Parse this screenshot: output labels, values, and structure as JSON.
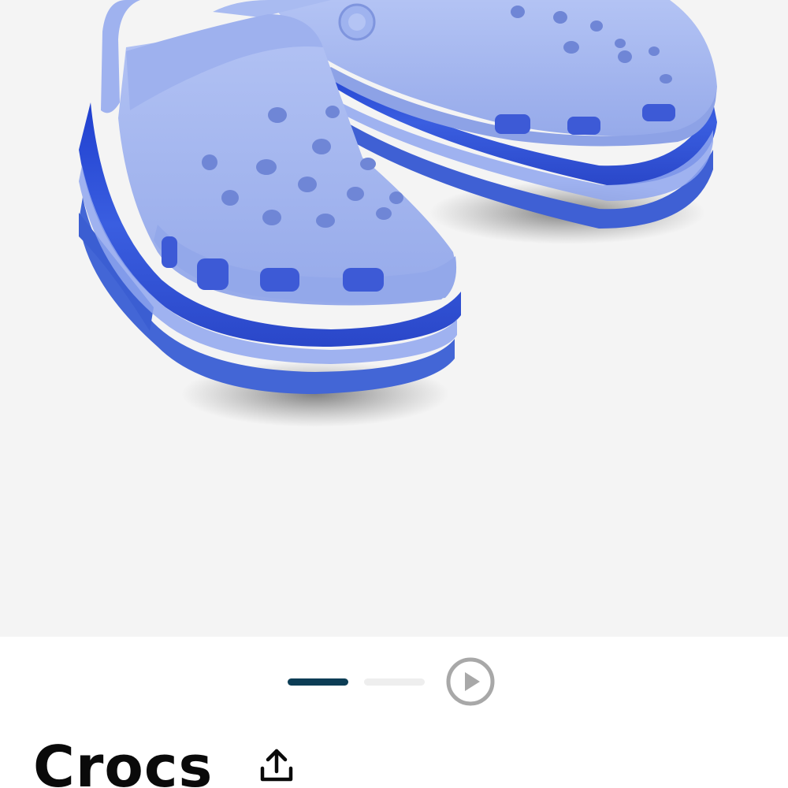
{
  "product": {
    "title": "Crocs",
    "colors": {
      "background": "#f4f4f4",
      "clog_body": "#a3b6f0",
      "platform_blue": "#2d4ed0",
      "indicator_active": "#0c3d55",
      "indicator_inactive": "#eeeeee",
      "play_icon": "#a8a8a8"
    }
  },
  "carousel": {
    "slides": 2,
    "active_slide": 1,
    "has_video": true
  },
  "icons": {
    "play": "play-circle-icon",
    "share": "share-upload-icon"
  }
}
